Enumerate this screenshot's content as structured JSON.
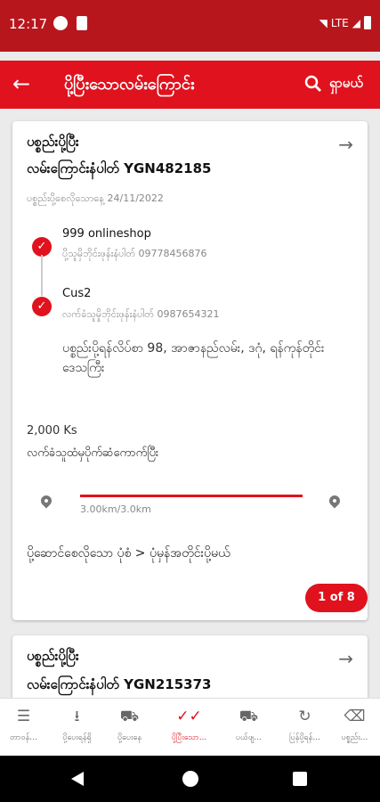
{
  "status_bar": {
    "time": "12:17",
    "network": "LTE"
  },
  "app_bar": {
    "back_icon": "back-arrow-icon",
    "title": "ပို့ပြီးသောလမ်းကြောင်း",
    "search_label": "ရှာမယ်"
  },
  "cards": [
    {
      "status": "ပစ္စည်းပို့ပြီး",
      "tracking": "လမ်းကြောင်းနံပါတ် YGN482185",
      "request_date": "ပစ္စည်းပို့စေလိုသောနေ့ 24/11/2022",
      "sender": {
        "name": "999 onlineshop",
        "phone": "ပို့သူမှိဘိုင်းဖုန်းနံပါတ် 09778456876"
      },
      "receiver": {
        "name": "Cus2",
        "phone": "လက်ခံသူမှိုဘိုင်းဖုန်းနံပါတ် 0987654321"
      },
      "address": "ပစ္စည်းပို့ရန်လိပ်စာ 98, အာဇာနည်လမ်း, ဒဂုံ, ရန်ကုန်တိုင်းဒေသကြီး",
      "price": "2,000 Ks",
      "payment_status": "လက်ခံသူထံမှပိုက်ဆံကောက်ပြီး",
      "distance": "3.00km/3.0km",
      "progress_fraction": 1.0,
      "service": "ပို့ဆောင်စေလိုသော ပုံစံ > ပုံမှန်အတိုင်းပို့မယ်",
      "pager": "1 of 8"
    },
    {
      "status": "ပစ္စည်းပို့ပြီး",
      "tracking": "လမ်းကြောင်းနံပါတ် YGN215373"
    }
  ],
  "bottom_nav": [
    {
      "icon": "list-icon",
      "label": "တာဝန်..."
    },
    {
      "icon": "download-icon",
      "label": "ပို့ပေးရန်ရှိ"
    },
    {
      "icon": "truck-icon",
      "label": "ပို့ပေးနေ"
    },
    {
      "icon": "double-check-icon",
      "label": "ပို့ပြီးသော...",
      "active": true
    },
    {
      "icon": "return-truck-icon",
      "label": "ပယ်ဖျ..."
    },
    {
      "icon": "refresh-icon",
      "label": "ပြန်ပို့ရန်..."
    },
    {
      "icon": "delete-icon",
      "label": "ပစ္စည်း..."
    }
  ],
  "colors": {
    "primary": "#e0121d",
    "status_bar": "#b8161d"
  }
}
